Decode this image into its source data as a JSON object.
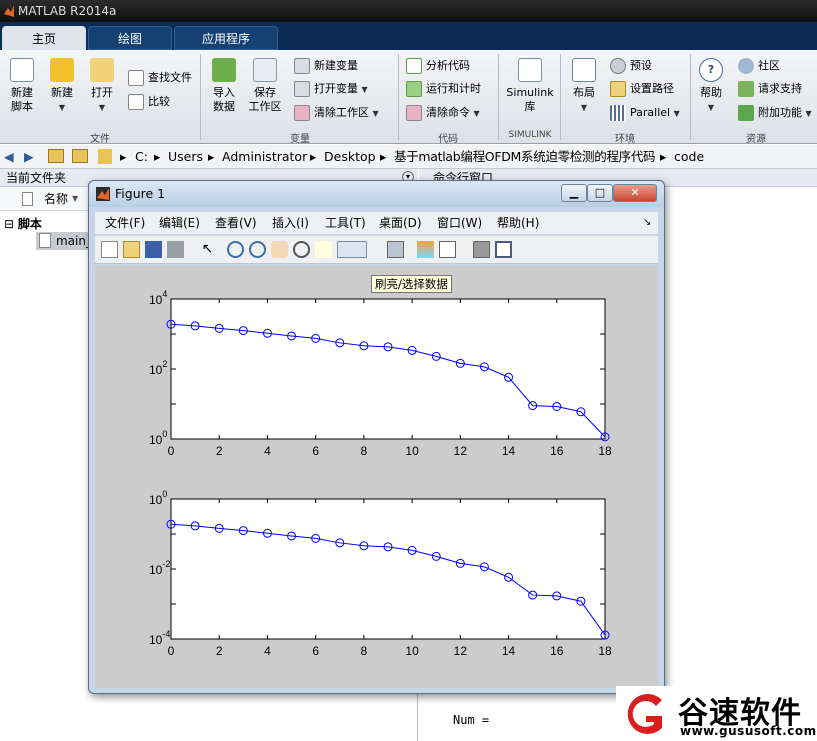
{
  "window": {
    "title": "MATLAB R2014a"
  },
  "tabs": [
    "主页",
    "绘图",
    "应用程序"
  ],
  "ribbon": {
    "file": {
      "new_script": "新建\n脚本",
      "new": "新建",
      "open": "打开",
      "find_files": "查找文件",
      "compare": "比较",
      "label": "文件"
    },
    "variable": {
      "import": "导入\n数据",
      "save_ws": "保存\n工作区",
      "new_var": "新建变量",
      "open_var": "打开变量",
      "clear_ws": "清除工作区",
      "label": "变量"
    },
    "code": {
      "analyze": "分析代码",
      "run_time": "运行和计时",
      "clear_cmd": "清除命令",
      "label": "代码"
    },
    "simulink": {
      "lib": "Simulink\n库",
      "label": "SIMULINK"
    },
    "env": {
      "layout": "布局",
      "prefs": "预设",
      "set_path": "设置路径",
      "parallel": "Parallel",
      "label": "环境"
    },
    "res": {
      "help": "帮助",
      "community": "社区",
      "support": "请求支持",
      "addons": "附加功能",
      "label": "资源"
    }
  },
  "address": [
    "C:",
    "Users",
    "Administrator",
    "Desktop",
    "基于matlab编程OFDM系统迫零检测的程序代码",
    "code"
  ],
  "left": {
    "title": "当前文件夹",
    "col_name": "名称",
    "group": "脚本",
    "file": "main_"
  },
  "cmd": {
    "title": "命令行窗口",
    "line": "Num ="
  },
  "figure": {
    "title": "Figure 1",
    "menu": [
      "文件(F)",
      "编辑(E)",
      "查看(V)",
      "插入(I)",
      "工具(T)",
      "桌面(D)",
      "窗口(W)",
      "帮助(H)"
    ],
    "tooltip": "刷亮/选择数据"
  },
  "watermark": {
    "name": "谷速软件",
    "url": "www.gususoft.com"
  },
  "chart_data": [
    {
      "type": "line",
      "yscale": "log",
      "xlim": [
        0,
        18
      ],
      "ylim": [
        1,
        10000
      ],
      "xticks": [
        "0",
        "2",
        "4",
        "6",
        "8",
        "10",
        "12",
        "14",
        "16",
        "18"
      ],
      "yticks": [
        "10^0",
        "10^2",
        "10^4"
      ],
      "x": [
        0,
        1,
        2,
        3,
        4,
        5,
        6,
        7,
        8,
        9,
        10,
        11,
        12,
        13,
        14,
        15,
        16,
        17,
        18
      ],
      "y": [
        1900,
        1700,
        1450,
        1250,
        1050,
        880,
        750,
        560,
        460,
        430,
        340,
        230,
        145,
        115,
        58,
        9,
        8.5,
        6,
        1.15
      ],
      "color": "#0000ff",
      "marker": "circle"
    },
    {
      "type": "line",
      "yscale": "log",
      "xlim": [
        0,
        18
      ],
      "ylim": [
        0.0001,
        1
      ],
      "xticks": [
        "0",
        "2",
        "4",
        "6",
        "8",
        "10",
        "12",
        "14",
        "16",
        "18"
      ],
      "yticks": [
        "10^-4",
        "10^-2",
        "10^0"
      ],
      "x": [
        0,
        1,
        2,
        3,
        4,
        5,
        6,
        7,
        8,
        9,
        10,
        11,
        12,
        13,
        14,
        15,
        16,
        17,
        18
      ],
      "y": [
        0.19,
        0.17,
        0.145,
        0.125,
        0.105,
        0.088,
        0.075,
        0.056,
        0.046,
        0.043,
        0.034,
        0.023,
        0.0145,
        0.0115,
        0.0058,
        0.0018,
        0.0017,
        0.0012,
        0.00013
      ],
      "color": "#0000ff",
      "marker": "circle"
    }
  ]
}
